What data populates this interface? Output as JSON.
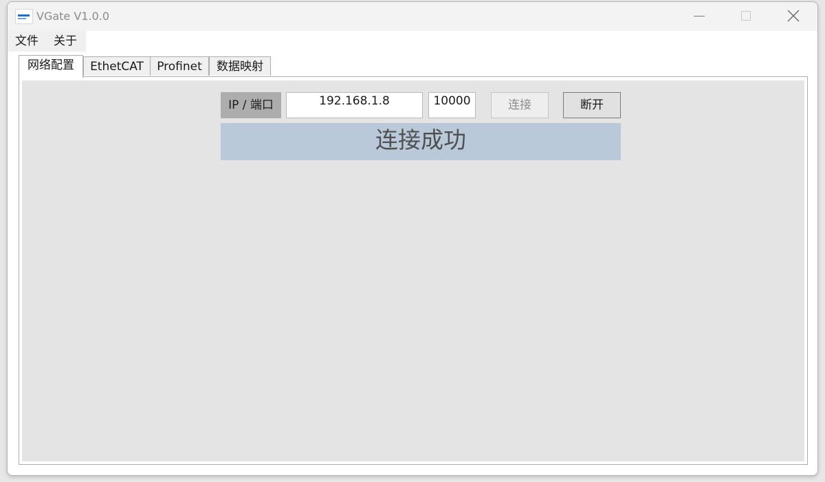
{
  "window": {
    "title": "VGate V1.0.0"
  },
  "menu": {
    "items": [
      {
        "label": "文件"
      },
      {
        "label": "关于"
      }
    ]
  },
  "tabs": [
    {
      "label": "网络配置",
      "active": true
    },
    {
      "label": "EthetCAT",
      "active": false
    },
    {
      "label": "Profinet",
      "active": false
    },
    {
      "label": "数据映射",
      "active": false
    }
  ],
  "network": {
    "ip_port_label": "IP / 端口",
    "ip_value": "192.168.1.8",
    "port_value": "10000",
    "connect_label": "连接",
    "connect_enabled": false,
    "disconnect_label": "断开",
    "status_text": "连接成功"
  },
  "icons": {
    "app": "app-logo-icon",
    "minimize": "minimize-icon",
    "maximize": "maximize-icon",
    "close": "close-icon"
  },
  "colors": {
    "status_background": "#b9c9da",
    "panel_background": "#e4e4e4",
    "label_background": "#adadad"
  }
}
